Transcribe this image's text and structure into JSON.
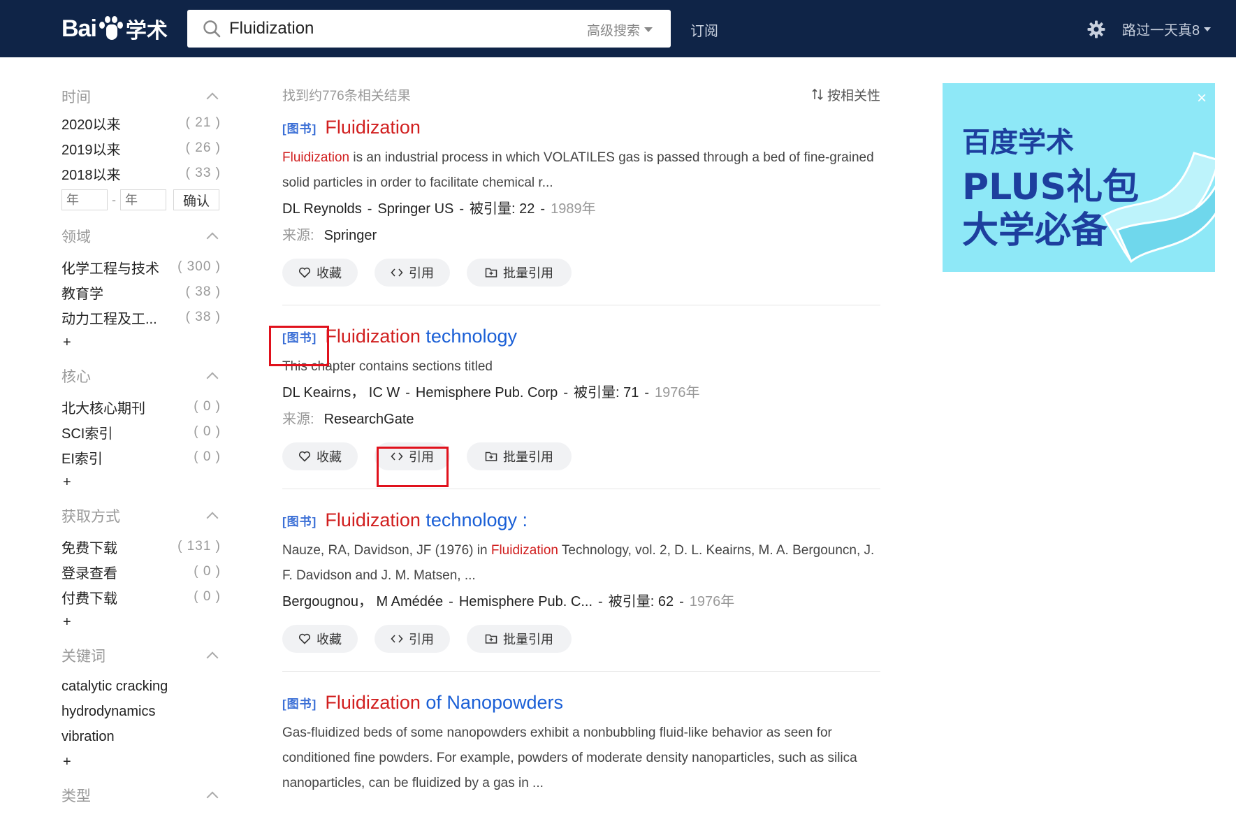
{
  "header": {
    "logo_text": "Bai",
    "logo_suffix": "学术",
    "search_value": "Fluidization",
    "advanced_search": "高级搜索",
    "subscribe": "订阅",
    "username": "路过一天真8"
  },
  "sidebar": {
    "time": {
      "title": "时间",
      "items": [
        {
          "label": "2020以来",
          "count": "( 21 )"
        },
        {
          "label": "2019以来",
          "count": "( 26 )"
        },
        {
          "label": "2018以来",
          "count": "( 33 )"
        }
      ],
      "year_from_placeholder": "年",
      "year_to_placeholder": "年",
      "confirm": "确认"
    },
    "field": {
      "title": "领域",
      "items": [
        {
          "label": "化学工程与技术",
          "count": "( 300 )"
        },
        {
          "label": "教育学",
          "count": "( 38 )"
        },
        {
          "label": "动力工程及工...",
          "count": "( 38 )"
        }
      ],
      "more": "+"
    },
    "core": {
      "title": "核心",
      "items": [
        {
          "label": "北大核心期刊",
          "count": "( 0 )"
        },
        {
          "label": "SCI索引",
          "count": "( 0 )"
        },
        {
          "label": "EI索引",
          "count": "( 0 )"
        }
      ],
      "more": "+"
    },
    "access": {
      "title": "获取方式",
      "items": [
        {
          "label": "免费下载",
          "count": "( 131 )"
        },
        {
          "label": "登录查看",
          "count": "( 0 )"
        },
        {
          "label": "付费下载",
          "count": "( 0 )"
        }
      ],
      "more": "+"
    },
    "keywords": {
      "title": "关键词",
      "items": [
        "catalytic cracking",
        "hydrodynamics",
        "vibration"
      ],
      "more": "+"
    },
    "type": {
      "title": "类型"
    }
  },
  "results": {
    "count_text": "找到约776条相关结果",
    "sort_label": "按相关性",
    "actions": {
      "favorite": "收藏",
      "cite": "引用",
      "batch_cite": "批量引用"
    },
    "items": [
      {
        "tag": "[图书]",
        "title_hl": "Fluidization",
        "title_rest": "",
        "abstract_hl": "Fluidization",
        "abstract_rest": " is an industrial process in which VOLATILES gas is passed through a bed of fine-grained solid particles in order to facilitate chemical r...",
        "authors": [
          "DL Reynolds",
          "Springer US"
        ],
        "cited_label": "被引量:",
        "cited": "22",
        "year": "1989年",
        "source_label": "来源:",
        "source": "Springer"
      },
      {
        "tag": "[图书]",
        "title_hl": "Fluidization",
        "title_rest": " technology",
        "abstract_text": "This chapter contains sections titled",
        "authors": [
          "DL Keairns，",
          "IC W",
          "Hemisphere Pub. Corp"
        ],
        "cited_label": "被引量:",
        "cited": "71",
        "year": "1976年",
        "source_label": "来源:",
        "source": "ResearchGate"
      },
      {
        "tag": "[图书]",
        "title_hl": "Fluidization",
        "title_rest": " technology :",
        "abstract_pre": "Nauze, RA, Davidson, JF (1976) in ",
        "abstract_hl": "Fluidization",
        "abstract_rest": " Technology, vol. 2, D. L. Keairns, M. A. Bergouncn, J. F. Davidson and J. M. Matsen, ...",
        "authors": [
          "Bergougnou，",
          "M Amédée",
          "Hemisphere Pub. C..."
        ],
        "cited_label": "被引量:",
        "cited": "62",
        "year": "1976年"
      },
      {
        "tag": "[图书]",
        "title_hl": "Fluidization",
        "title_rest": " of Nanopowders",
        "abstract_text": "Gas-fluidized beds of some nanopowders exhibit a nonbubbling fluid-like behavior as seen for conditioned fine powders. For example, powders of moderate density nanoparticles, such as silica nanoparticles, can be fluidized by a gas in ..."
      }
    ]
  },
  "ad": {
    "line1": "百度学术",
    "line2": "PLUS礼包",
    "line3": "大学必备",
    "close": "×"
  },
  "colors": {
    "header_bg": "#0f2447",
    "link_blue": "#1a5fd6",
    "highlight_red": "#d11f1f",
    "annotation_red": "#e0111c"
  }
}
